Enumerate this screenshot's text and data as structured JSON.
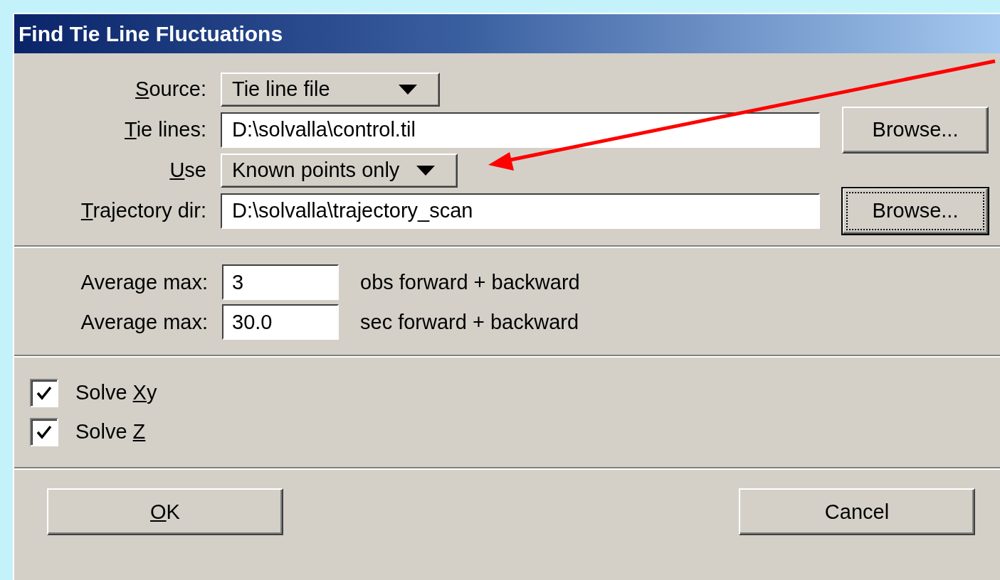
{
  "window": {
    "title": "Find Tie Line Fluctuations"
  },
  "file_rows": [
    {
      "kind": "dropdown",
      "label": {
        "key": "S",
        "post": "ource:"
      },
      "value": "Tie line file"
    },
    {
      "kind": "field",
      "label": {
        "key": "T",
        "post": "ie lines:"
      },
      "value": "D:\\solvalla\\control.til",
      "browse": {
        "label": "Browse...",
        "focused": false
      }
    },
    {
      "kind": "dropdown",
      "label": {
        "key": "U",
        "post": "se"
      },
      "value": "Known points only"
    },
    {
      "kind": "field",
      "label": {
        "key": "T",
        "post": "rajectory dir:"
      },
      "value": "D:\\solvalla\\trajectory_scan",
      "browse": {
        "label": "Browse...",
        "focused": true
      }
    }
  ],
  "averages": [
    {
      "label": "Average max:",
      "value": "3",
      "unit": "obs forward + backward"
    },
    {
      "label": "Average max:",
      "value": "30.0",
      "unit": "sec forward + backward"
    }
  ],
  "options": [
    {
      "label": {
        "pre": "Solve ",
        "key": "X",
        "post": "y"
      },
      "checked": true
    },
    {
      "label": {
        "pre": "Solve ",
        "key": "Z"
      },
      "checked": true
    }
  ],
  "buttons": [
    {
      "label": {
        "key": "O",
        "post": "K"
      }
    },
    {
      "label": {
        "pre": "Cancel"
      }
    }
  ]
}
